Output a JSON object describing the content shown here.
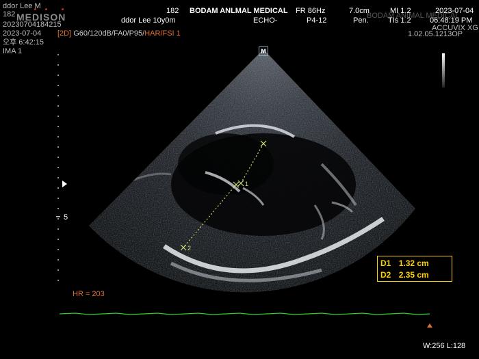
{
  "header": {
    "patient_name": "ddor Lee M",
    "patient_id_short": "182",
    "brand": "MEDISON",
    "study_id": "20230704184215",
    "date_left": "2023-07-04",
    "mode_line_prefix": "[2D]",
    "mode_line_params": "G60/120dB/FA0/P95/",
    "mode_line_har": "HAR/FSI 1",
    "time_left": "오후 6:42:15",
    "image_index": "IMA 1",
    "center_id": "182",
    "center_name": "ddor Lee 10y0m",
    "institution": "BODAM ANLMAL MEDICAL",
    "study_type": "ECHO-",
    "frame_rate": "FR 86Hz",
    "probe": "P4-12",
    "depth": "7.0cm",
    "preset": "Pen.",
    "mi": "MI 1.2",
    "tis": "TIs 1.2",
    "date_right": "2023-07-04",
    "time_right": "06:48:19 PM",
    "institution_right": "BODAM ANIMAL MEDICAL",
    "accuvix": "ACCUVIX XG",
    "version": "1.02.05.1213OP"
  },
  "scan": {
    "depth_label": "5",
    "probe_marker": "M"
  },
  "measurements": [
    {
      "label": "D1",
      "value": "1.32 cm"
    },
    {
      "label": "D2",
      "value": "2.35 cm"
    }
  ],
  "calipers": {
    "p1_label": "1",
    "p2_label": "2"
  },
  "ecg": {
    "hr_text": "HR = 203"
  },
  "footer": {
    "window_level": "W:256 L:128"
  },
  "colors": {
    "caliper": "#c8e070",
    "measurement": "#ffd200",
    "hr": "#e07030",
    "ecg": "#33cc33"
  }
}
